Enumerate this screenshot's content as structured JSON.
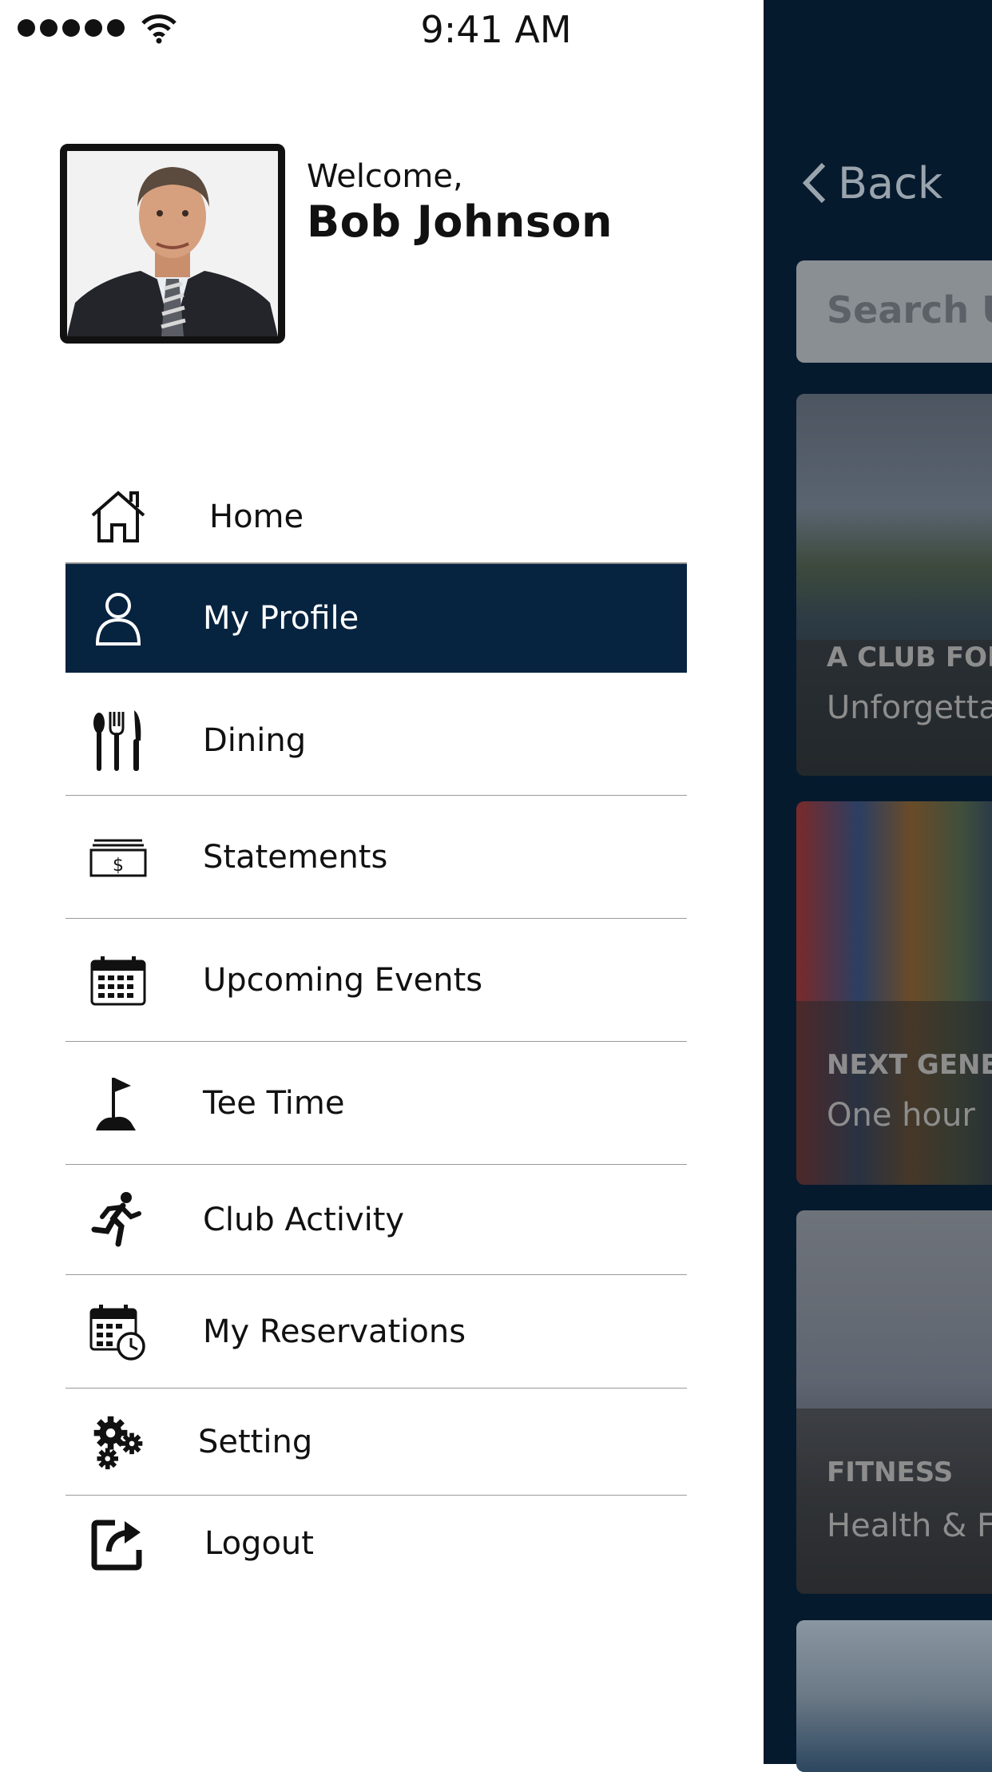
{
  "status_bar": {
    "time": "9:41 AM"
  },
  "profile": {
    "welcome": "Welcome,",
    "name": "Bob Johnson"
  },
  "menu": [
    {
      "label": "Home",
      "icon": "home-icon"
    },
    {
      "label": "My Profile",
      "icon": "user-icon",
      "active": true
    },
    {
      "label": "Dining",
      "icon": "cutlery-icon"
    },
    {
      "label": "Statements",
      "icon": "bill-icon"
    },
    {
      "label": "Upcoming Events",
      "icon": "calendar-icon"
    },
    {
      "label": "Tee Time",
      "icon": "golf-flag-icon"
    },
    {
      "label": "Club Activity",
      "icon": "runner-icon"
    },
    {
      "label": "My Reservations",
      "icon": "calendar-clock-icon"
    },
    {
      "label": "Setting",
      "icon": "gears-icon"
    },
    {
      "label": "Logout",
      "icon": "logout-icon"
    }
  ],
  "background_screen": {
    "back_label": "Back",
    "search_placeholder": "Search U",
    "cards": [
      {
        "kicker": "A CLUB FOR",
        "title": "Unforgetta"
      },
      {
        "kicker": "NEXT GENE",
        "title": "One hour"
      },
      {
        "kicker": "FITNESS",
        "title": "Health & F"
      }
    ]
  },
  "colors": {
    "accent": "#062340",
    "background_screen": "#061a2e",
    "divider": "#9a9a9a"
  }
}
